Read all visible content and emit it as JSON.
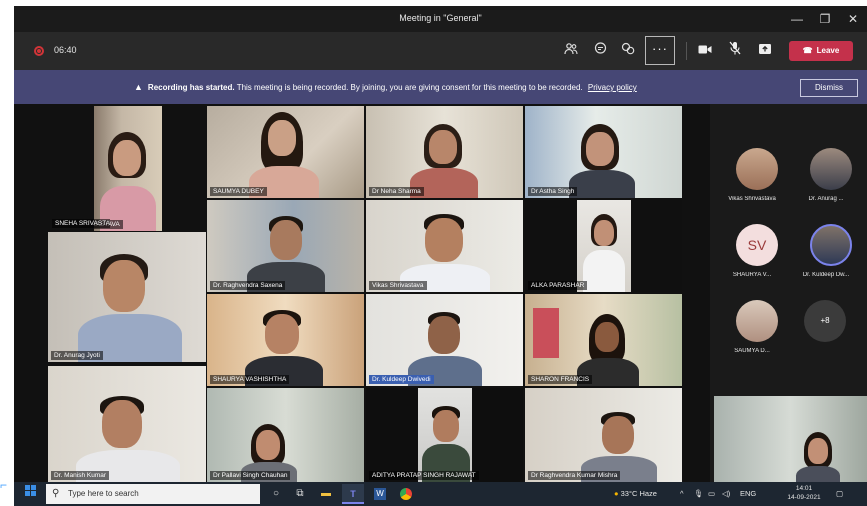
{
  "window": {
    "title": "Meeting in \"General\"",
    "minimize": "—",
    "maximize": "❐",
    "close": "✕"
  },
  "toolbar": {
    "timer": "06:40",
    "more_label": "···",
    "leave_label": "Leave"
  },
  "banner": {
    "bold": "Recording has started.",
    "text": "This meeting is being recorded. By joining, you are giving consent for this meeting to be recorded.",
    "link": "Privacy policy",
    "dismiss": "Dismiss"
  },
  "tiles": [
    "SNEHA SRIVASTAVA",
    "SAUMYA DUBEY",
    "Dr Neha Sharma",
    "Dr Astha Singh",
    "Dr. Anurag Jyoti",
    "Dr. Raghvendra Saxena",
    "Vikas Shrivastava",
    "ALKA PARASHAR",
    "SHAURYA VASHISHTHA",
    "Dr. Kuldeep Dwivedi",
    "SHARON FRANCIS",
    "Dr. Manish Kumar",
    "Dr Pallavi Singh Chauhan",
    "ADITYA PRATAP SINGH RAJAWAT",
    "Dr Raghvendra Kumar Mishra"
  ],
  "panel": {
    "people": [
      "Vikas Shrivastava",
      "Dr. Anurag ...",
      "SHAURYA V...",
      "Dr. Kuldeep Dw...",
      "SAUMYA D..."
    ],
    "initials": "SV",
    "overflow": "+8"
  },
  "taskbar": {
    "search_placeholder": "Type here to search",
    "weather": "33°C Haze",
    "lang": "ENG",
    "time": "14:01",
    "date": "14-09-2021"
  },
  "colors": {
    "banner": "#464775",
    "leave": "#c4314b",
    "taskbar": "#1d2631"
  }
}
